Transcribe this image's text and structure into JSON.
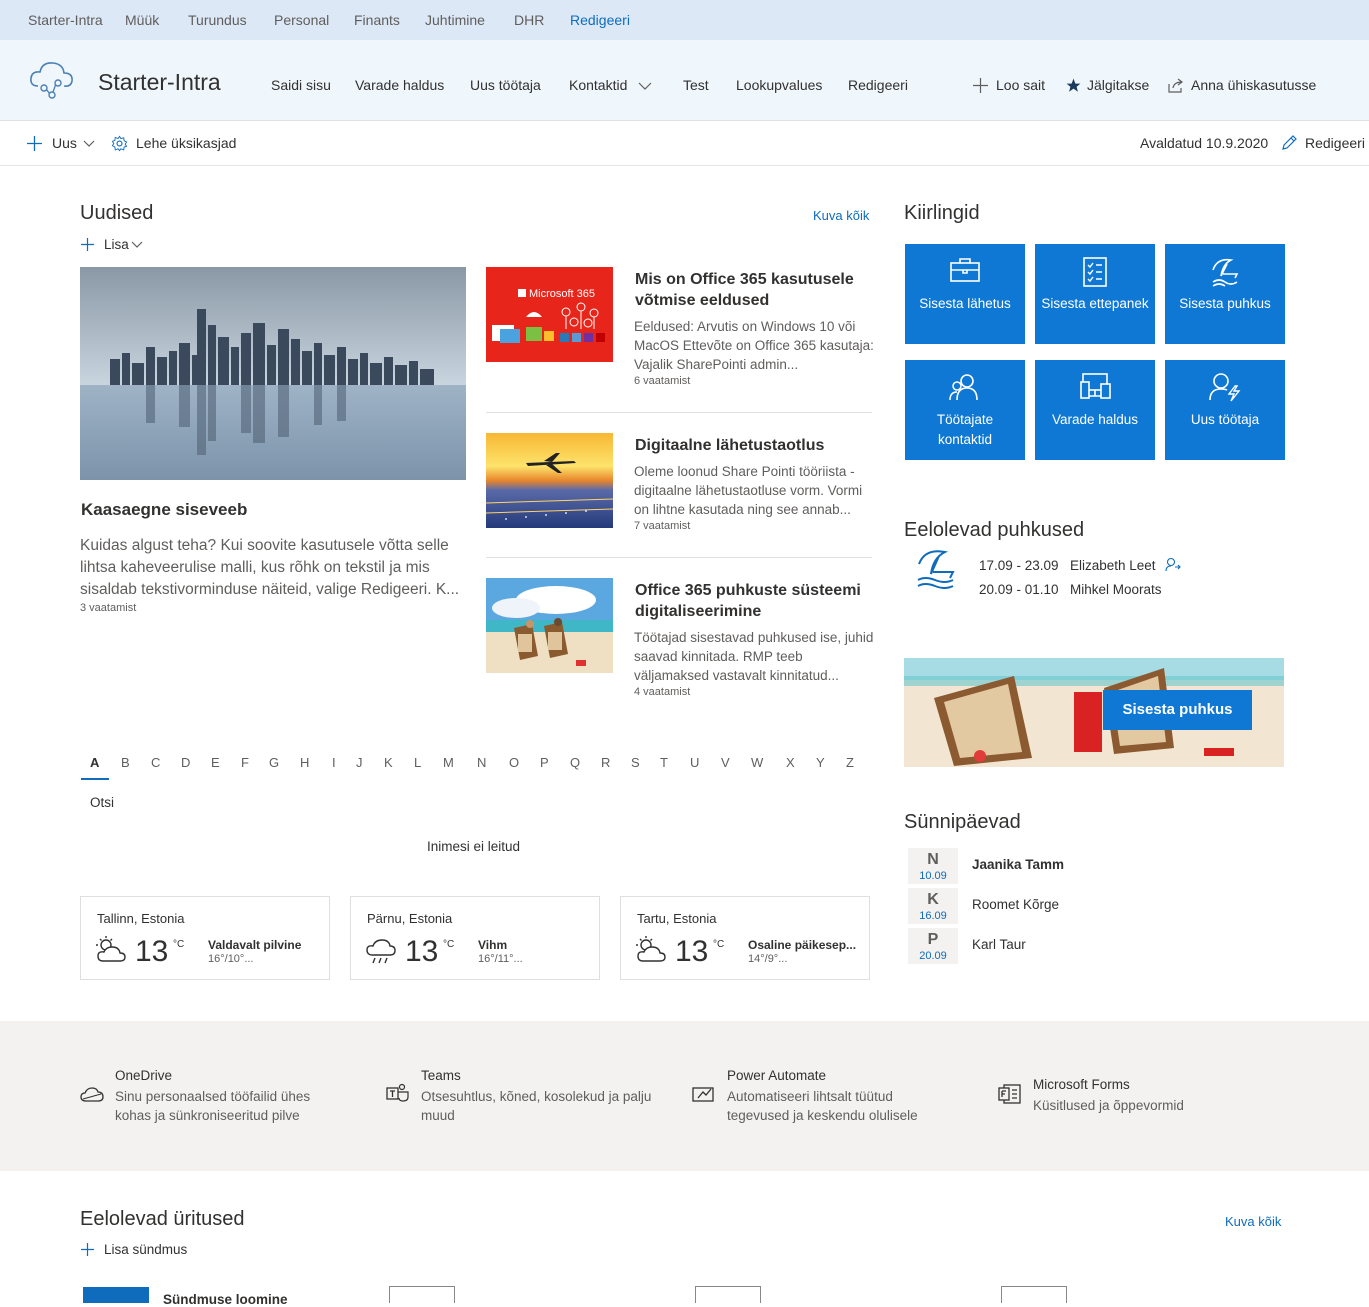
{
  "topnav": {
    "items": [
      "Starter-Intra",
      "Müük",
      "Turundus",
      "Personal",
      "Finants",
      "Juhtimine",
      "DHR"
    ],
    "edit": "Redigeeri"
  },
  "site": {
    "title": "Starter-Intra",
    "nav": [
      "Saidi sisu",
      "Varade haldus",
      "Uus töötaja",
      "Kontaktid",
      "Test",
      "Lookupvalues",
      "Redigeeri"
    ],
    "actions": {
      "create": "Loo sait",
      "follow": "Jälgitakse",
      "share": "Anna ühiskasutusse"
    }
  },
  "cmdbar": {
    "new": "Uus",
    "page_details": "Lehe üksikasjad",
    "published": "Avaldatud 10.9.2020",
    "edit": "Redigeeri"
  },
  "news": {
    "title": "Uudised",
    "see_all": "Kuva kõik",
    "add": "Lisa",
    "hero": {
      "title": "Kaasaegne siseveeb",
      "desc": "Kuidas algust teha? Kui soovite kasutusele võtta selle lihtsa kaheveerulise malli, kus rõhk on tekstil ja mis sisaldab tekstivorminduse näiteid, valige Redigeeri. K...",
      "views": "3 vaatamist"
    },
    "items": [
      {
        "title": "Mis on Office 365 kasutusele võtmise eeldused",
        "desc": "Eeldused: Arvutis on Windows 10 või MacOS Ettevõte on Office 365 kasutaja: Vajalik SharePointi admin...",
        "views": "6 vaatamist",
        "img_text": "Microsoft 365"
      },
      {
        "title": "Digitaalne lähetustaotlus",
        "desc": "Oleme loonud Share Pointi tööriista - digitaalne lähetustaotluse vorm. Vormi on lihtne kasutada ning see annab...",
        "views": "7 vaatamist"
      },
      {
        "title": "Office 365 puhkuste süsteemi digitaliseerimine",
        "desc": "Töötajad sisestavad puhkused ise, juhid saavad kinnitada. RMP teeb väljamaksed vastavalt kinnitatud...",
        "views": "4 vaatamist"
      }
    ]
  },
  "quicklinks": {
    "title": "Kiirlingid",
    "items": [
      "Sisesta lähetus",
      "Sisesta ettepanek",
      "Sisesta puhkus",
      "Töötajate kontaktid",
      "Varade haldus",
      "Uus töötaja"
    ]
  },
  "holidays": {
    "title": "Eelolevad puhkused",
    "rows": [
      {
        "dates": "17.09 - 23.09",
        "name": "Elizabeth Leet"
      },
      {
        "dates": "20.09 - 01.10",
        "name": "Mihkel Moorats"
      }
    ]
  },
  "vacation_banner": {
    "button": "Sisesta puhkus"
  },
  "directory": {
    "letters": [
      "A",
      "B",
      "C",
      "D",
      "E",
      "F",
      "G",
      "H",
      "I",
      "J",
      "K",
      "L",
      "M",
      "N",
      "O",
      "P",
      "Q",
      "R",
      "S",
      "T",
      "U",
      "V",
      "W",
      "X",
      "Y",
      "Z"
    ],
    "selected": "A",
    "search": "Otsi",
    "empty": "Inimesi ei leitud"
  },
  "weather": [
    {
      "city": "Tallinn, Estonia",
      "temp": "13",
      "unit": "°C",
      "cond": "Valdavalt pilvine",
      "range": "16°/10°...",
      "icon": "partly-cloudy-icon"
    },
    {
      "city": "Pärnu, Estonia",
      "temp": "13",
      "unit": "°C",
      "cond": "Vihm",
      "range": "16°/11°...",
      "icon": "rain-icon"
    },
    {
      "city": "Tartu, Estonia",
      "temp": "13",
      "unit": "°C",
      "cond": "Osaline päikesep...",
      "range": "14°/9°...",
      "icon": "partly-sunny-icon"
    }
  ],
  "birthdays": {
    "title": "Sünnipäevad",
    "items": [
      {
        "day": "N",
        "date": "10.09",
        "name": "Jaanika Tamm"
      },
      {
        "day": "K",
        "date": "16.09",
        "name": "Roomet Kõrge"
      },
      {
        "day": "P",
        "date": "20.09",
        "name": "Karl Taur"
      }
    ]
  },
  "apps": [
    {
      "title": "OneDrive",
      "desc": "Sinu personaalsed tööfailid ühes kohas ja sünkroniseeritud pilve"
    },
    {
      "title": "Teams",
      "desc": "Otsesuhtlus, kõned, kosolekud ja palju muud"
    },
    {
      "title": "Power Automate",
      "desc": "Automatiseeri lihtsalt tüütud tegevused ja keskendu olulisele"
    },
    {
      "title": "Microsoft Forms",
      "desc": "Küsitlused ja õppevormid"
    }
  ],
  "events": {
    "title": "Eelolevad üritused",
    "see_all": "Kuva kõik",
    "add": "Lisa sündmus",
    "first": "Sündmuse loomine"
  },
  "colors": {
    "accent": "#0f6cbd",
    "tile": "#0f78d4",
    "topnav_bg": "#dce8f6"
  }
}
